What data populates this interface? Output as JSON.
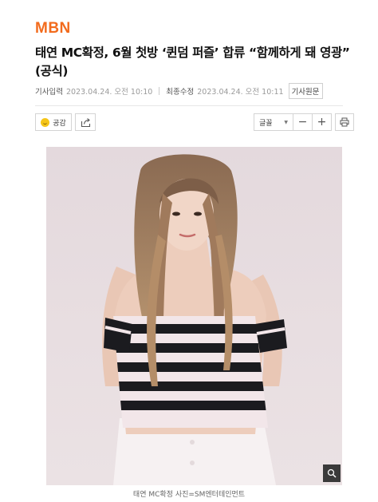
{
  "header": {
    "logo": "MBN"
  },
  "article": {
    "title_line1": "태연 MC확정, 6월 첫방 ‘퀸덤 퍼즐’ 합류 “함께하게 돼 영광”",
    "title_line2": "(공식)",
    "published_label": "기사입력",
    "published_value": "2023.04.24. 오전 10:10",
    "modified_label": "최종수정",
    "modified_value": "2023.04.24. 오전 10:11",
    "original_link": "기사원문"
  },
  "toolbar": {
    "like_label": "공감",
    "font_label": "글꼴",
    "minus": "−",
    "plus": "+"
  },
  "photo": {
    "caption": "태연 MC확정 사진=SM엔터테인먼트"
  },
  "colors": {
    "brand": "#f26b1d",
    "stripe_dark": "#1b1b1f",
    "stripe_light": "#f2e6e9",
    "background_photo": "#e6dcdf"
  }
}
